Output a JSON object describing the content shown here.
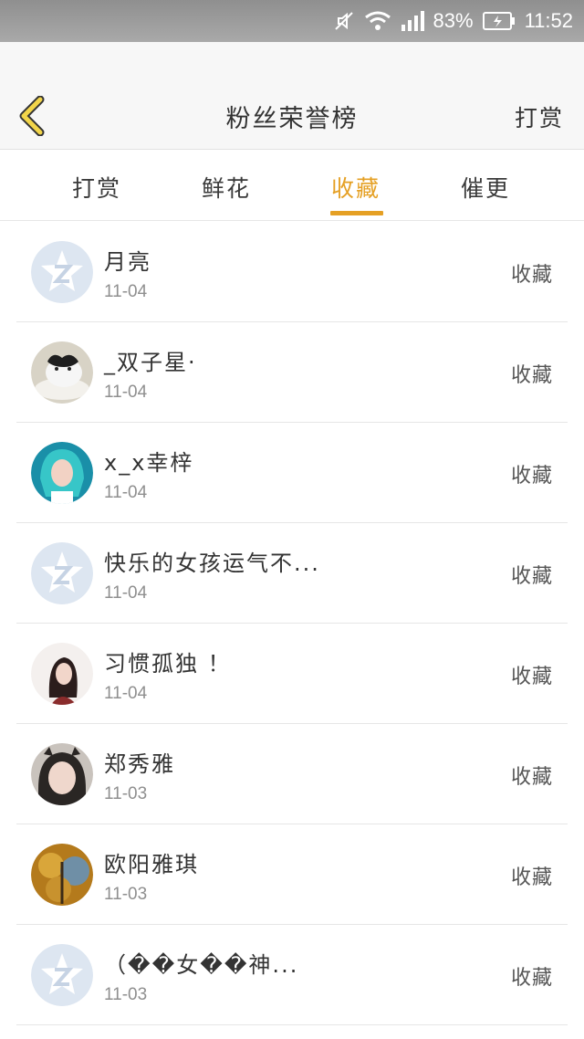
{
  "status_bar": {
    "battery": "83%",
    "time": "11:52"
  },
  "header": {
    "title": "粉丝荣誉榜",
    "right_action": "打赏"
  },
  "tabs": [
    {
      "label": "打赏"
    },
    {
      "label": "鲜花"
    },
    {
      "label": "收藏"
    },
    {
      "label": "催更"
    }
  ],
  "active_tab": "收藏",
  "accent_color": "#e5a024",
  "rows": [
    {
      "name": "月亮",
      "date": "11-04",
      "action": "收藏",
      "avatar": "default-avatar"
    },
    {
      "name": "_双子星·",
      "date": "11-04",
      "action": "收藏",
      "avatar": "cat-photo"
    },
    {
      "name": "x_x幸梓",
      "date": "11-04",
      "action": "收藏",
      "avatar": "teal-hair-photo"
    },
    {
      "name": "快乐的女孩运气不...",
      "date": "11-04",
      "action": "收藏",
      "avatar": "default-avatar"
    },
    {
      "name": "习惯孤独 ！",
      "date": "11-04",
      "action": "收藏",
      "avatar": "girl-photo"
    },
    {
      "name": "郑秀雅",
      "date": "11-03",
      "action": "收藏",
      "avatar": "girl-photo"
    },
    {
      "name": "欧阳雅琪",
      "date": "11-03",
      "action": "收藏",
      "avatar": "autumn-photo"
    },
    {
      "name": "（��女��神...",
      "date": "11-03",
      "action": "收藏",
      "avatar": "default-avatar"
    }
  ]
}
